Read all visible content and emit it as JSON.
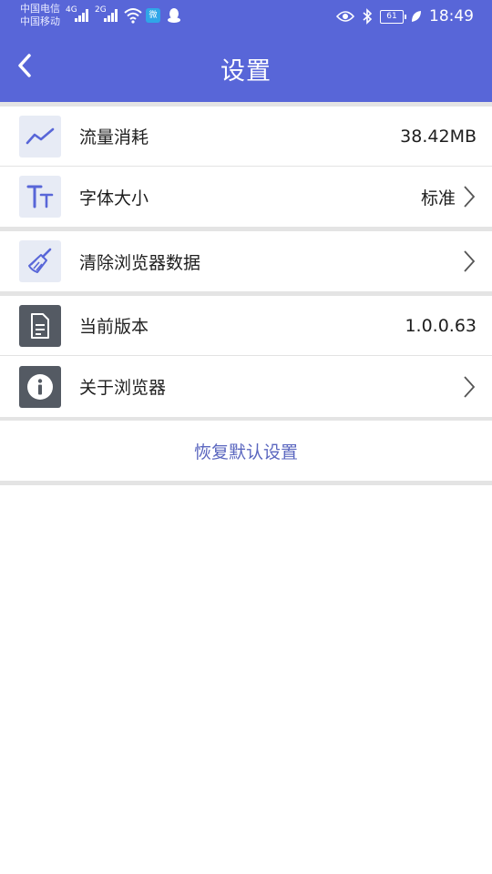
{
  "status_bar": {
    "carrier_1": "中国电信",
    "carrier_2": "中国移动",
    "network_1": "4G",
    "network_2": "2G",
    "badge": "微",
    "battery": "61",
    "time": "18:49"
  },
  "header": {
    "title": "设置",
    "color": "#5866d8"
  },
  "settings": {
    "data_usage": {
      "label": "流量消耗",
      "value": "38.42MB",
      "icon": "trend-line-icon"
    },
    "font_size": {
      "label": "字体大小",
      "value": "标准",
      "icon": "font-size-icon"
    },
    "clear_data": {
      "label": "清除浏览器数据",
      "icon": "broom-icon"
    },
    "version": {
      "label": "当前版本",
      "value": "1.0.0.63",
      "icon": "document-icon"
    },
    "about": {
      "label": "关于浏览器",
      "icon": "info-icon"
    }
  },
  "reset_label": "恢复默认设置"
}
